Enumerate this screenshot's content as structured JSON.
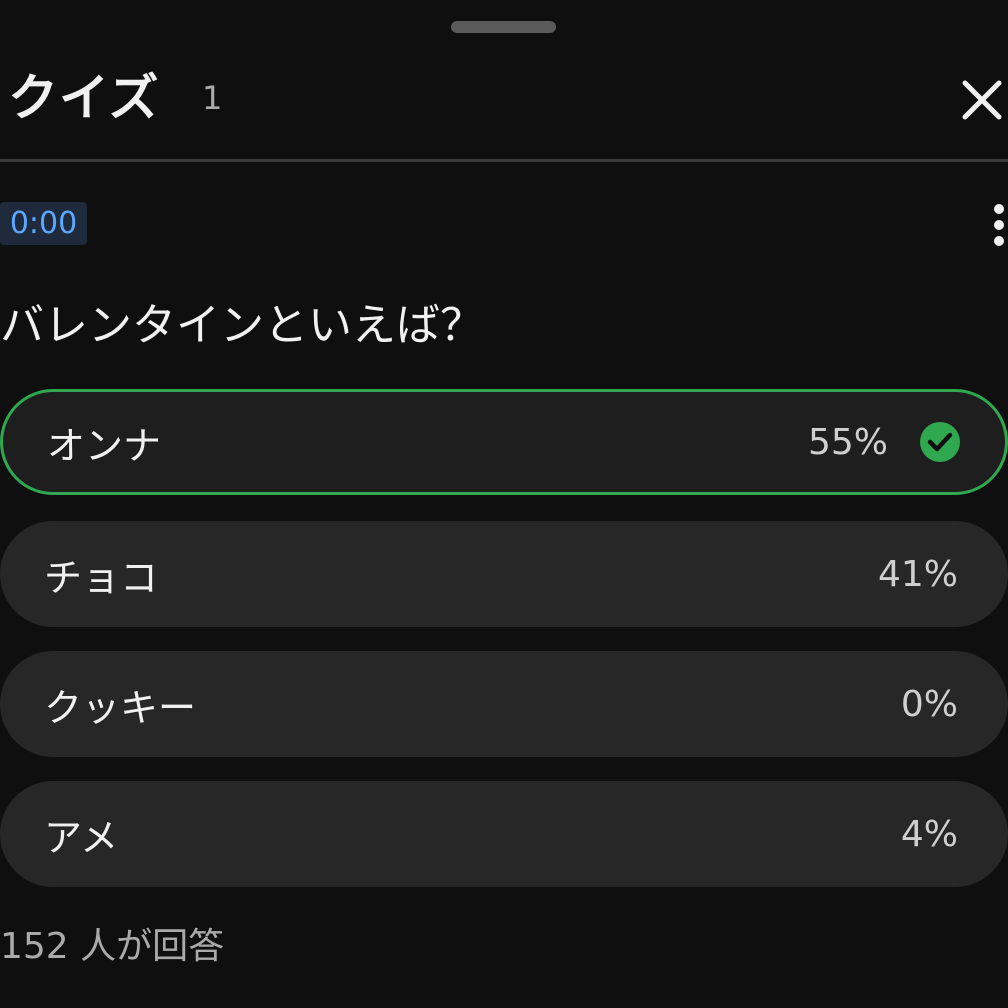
{
  "header": {
    "title": "クイズ",
    "count": "1"
  },
  "quiz": {
    "timer": "0:00",
    "question": "バレンタインといえば？",
    "options": [
      {
        "label": "オンナ",
        "percent": "55%",
        "correct": true
      },
      {
        "label": "チョコ",
        "percent": "41%",
        "correct": false
      },
      {
        "label": "クッキー",
        "percent": "0%",
        "correct": false
      },
      {
        "label": "アメ",
        "percent": "4%",
        "correct": false
      }
    ],
    "responses": "152 人が回答"
  },
  "icons": {
    "close": "close-icon",
    "more": "more-vert-icon",
    "check": "check-circle-icon"
  },
  "colors": {
    "background": "#0f0f0f",
    "option_background": "#272727",
    "correct_border": "#2fa84f",
    "timer_text": "#5aa8ff"
  }
}
